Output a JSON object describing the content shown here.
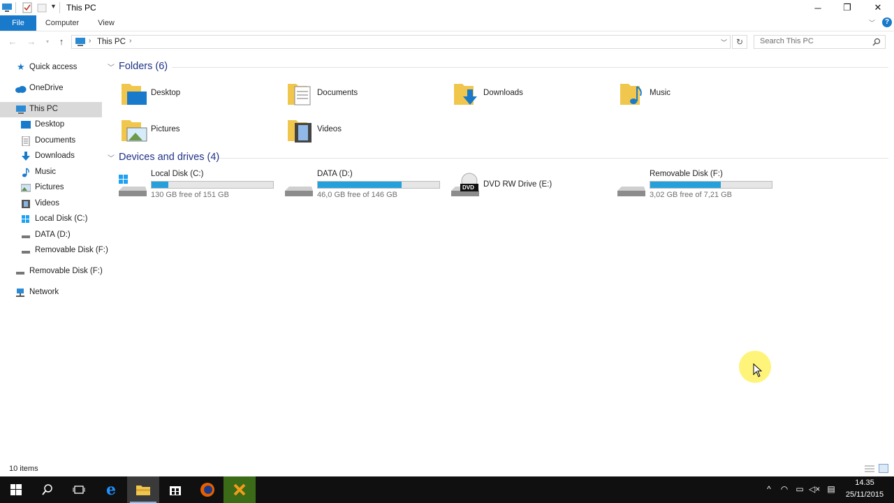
{
  "window": {
    "title": "This PC",
    "minimize_glyph": "─",
    "restore_glyph": "❐",
    "close_glyph": "✕"
  },
  "ribbon": {
    "tabs": [
      {
        "label": "File",
        "active": true
      },
      {
        "label": "Computer"
      },
      {
        "label": "View"
      }
    ],
    "help_glyph": "?"
  },
  "address": {
    "path": [
      "This PC"
    ],
    "search_placeholder": "Search This PC"
  },
  "nav": {
    "quick_access": "Quick access",
    "onedrive": "OneDrive",
    "this_pc": "This PC",
    "children": [
      {
        "label": "Desktop",
        "icon": "desktop-icon"
      },
      {
        "label": "Documents",
        "icon": "documents-icon"
      },
      {
        "label": "Downloads",
        "icon": "downloads-icon"
      },
      {
        "label": "Music",
        "icon": "music-icon"
      },
      {
        "label": "Pictures",
        "icon": "pictures-icon"
      },
      {
        "label": "Videos",
        "icon": "videos-icon"
      },
      {
        "label": "Local Disk (C:)",
        "icon": "windows-drive-icon"
      },
      {
        "label": "DATA (D:)",
        "icon": "drive-icon"
      },
      {
        "label": "Removable Disk (F:)",
        "icon": "usb-drive-icon"
      }
    ],
    "removable": "Removable Disk (F:)",
    "network": "Network"
  },
  "content": {
    "folders_header": "Folders (6)",
    "folders": [
      "Desktop",
      "Documents",
      "Downloads",
      "Music",
      "Pictures",
      "Videos"
    ],
    "drives_header": "Devices and drives (4)",
    "drives": [
      {
        "name": "Local Disk (C:)",
        "free": "130 GB free of 151 GB",
        "used_fraction": 0.14
      },
      {
        "name": "DATA (D:)",
        "free": "46,0 GB free of 146 GB",
        "used_fraction": 0.69
      },
      {
        "name": "DVD RW Drive (E:)",
        "free": "",
        "dvd_label": "DVD"
      },
      {
        "name": "Removable Disk (F:)",
        "free": "3,02 GB free of 7,21 GB",
        "used_fraction": 0.58
      }
    ]
  },
  "status": {
    "item_count": "10 items"
  },
  "taskbar": {
    "time": "14.35",
    "date": "25/11/2015"
  },
  "colors": {
    "accent": "#1979ca",
    "bar_fill": "#26a0da",
    "header_text": "#1e3287",
    "taskbar": "#101010",
    "folder": "#f1c64c"
  }
}
